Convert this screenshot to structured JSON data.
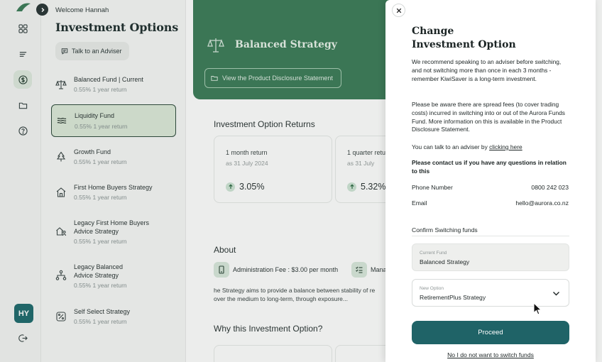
{
  "sidebar_rail": {
    "icons": [
      "logo-icon",
      "grid-icon",
      "list-icon",
      "dollar-icon",
      "folder-icon",
      "help-icon",
      "logout-icon"
    ],
    "avatar_initials": "HY"
  },
  "panel": {
    "welcome": "Welcome Hannah",
    "title": "Investment Options",
    "adviser_button": "Talk to an Adviser",
    "options": [
      {
        "name": "Balanced Fund | Current",
        "returns": "0.55% 1 year return",
        "icon": "scale-icon"
      },
      {
        "name": "Liquidity Fund",
        "returns": "0.55% 1 year return",
        "icon": "waves-icon",
        "active": true
      },
      {
        "name": "Growth Fund",
        "returns": "0.55% 1 year return",
        "icon": "tree-icon"
      },
      {
        "name": "First Home Buyers Strategy",
        "returns": "0.55% 1 year return",
        "icon": "house-icon"
      },
      {
        "name": "Legacy First Home Buyers Advice Strategy",
        "returns": "0.55% 1 year return",
        "icon": "house-people-icon"
      },
      {
        "name": "Legacy Balanced Advice Strategy",
        "returns": "0.55% 1 year return",
        "icon": "network-icon"
      },
      {
        "name": "Self Select Strategy",
        "returns": "0.55% 1 year return",
        "icon": "percent-icon"
      }
    ]
  },
  "main": {
    "hero_title": "Balanced Strategy",
    "pds_button": "View the Product Disclosure Statement",
    "returns_title": "Investment Option Returns",
    "returns": [
      {
        "label": "1 month return",
        "date": "as 31 July 2024",
        "value": "3.05%"
      },
      {
        "label": "1 quarter retu",
        "date": "as 31 July",
        "value": "5.32%"
      }
    ],
    "about_title": "About",
    "fee_text": "Administration Fee : $3.00 per month",
    "fee_text_2": "Mana",
    "about_text": "he Strategy aims to provide a balance between stability of re over the medium to long-term, through exposure...",
    "why_title": "Why this Investment Option?"
  },
  "drawer": {
    "title_line1": "Change",
    "title_line2": "Investment Option",
    "para1": "We recommend speaking to an adviser before switching, and not switching more than once in each 3 months - remember KiwiSaver is a long-term investment.",
    "para2": "Please be aware there are spread fees (to cover trading costs) incurred in switching into or out of the Aurora Funds Fund. More information on this is available in the Product Disclosure Statement.",
    "para3_prefix": "You can talk to an adviser by ",
    "para3_link": "clicking here",
    "contact_heading": "Please contact us if you have any questions in relation to this",
    "phone_label": "Phone Number",
    "phone_value": "0800 242 023",
    "email_label": "Email",
    "email_value": "hello@aurora.co.nz",
    "confirm_heading": "Confirm Switching funds",
    "current_fund_label": "Current Fund",
    "current_fund_value": "Balanced Strategy",
    "new_option_label": "New Option",
    "new_option_value": "RetirementPlus Strategy",
    "proceed_label": "Proceed",
    "decline_label": "No I do not want to switch funds"
  },
  "colors": {
    "brand_green": "#3d7d5a",
    "primary_teal": "#1f6367",
    "active_option_bg": "#dcead9"
  }
}
